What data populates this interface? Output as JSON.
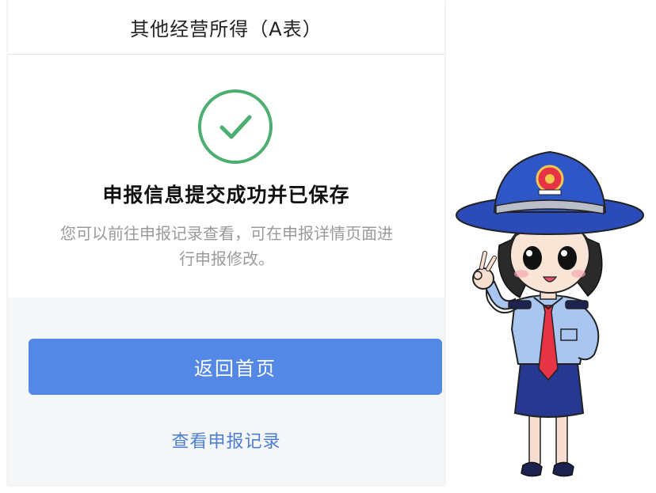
{
  "header": {
    "title": "其他经营所得（A表）"
  },
  "result": {
    "icon": "check-circle-icon",
    "title": "申报信息提交成功并已保存",
    "description_line1": "您可以前往申报记录查看，可在申报详情页面进",
    "description_line2": "行申报修改。"
  },
  "actions": {
    "primary_label": "返回首页",
    "secondary_label": "查看申报记录"
  },
  "colors": {
    "success_green": "#4caf72",
    "primary_blue": "#5388e6",
    "link_blue": "#4d7ed4",
    "mascot_navy": "#26388f",
    "mascot_shirt": "#a9c6f0",
    "mascot_tie": "#e63346"
  }
}
